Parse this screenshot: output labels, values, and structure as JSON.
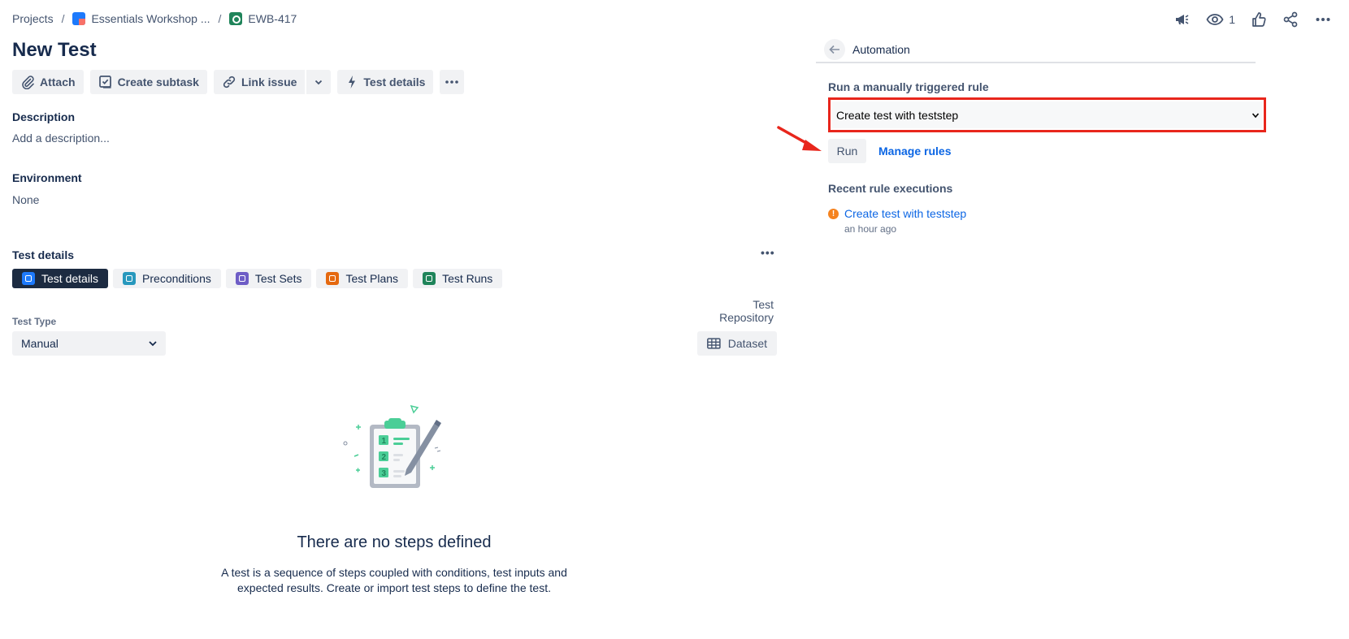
{
  "breadcrumb": {
    "projects": "Projects",
    "project": "Essentials Workshop ...",
    "issue_key": "EWB-417",
    "separator": "/"
  },
  "header_actions": {
    "watch_count": "1",
    "icons": [
      "megaphone-icon",
      "eye-icon",
      "thumbs-up-icon",
      "share-icon",
      "more-icon"
    ]
  },
  "issue": {
    "title": "New Test"
  },
  "toolbar": {
    "attach": "Attach",
    "create_subtask": "Create subtask",
    "link_issue": "Link issue",
    "test_details": "Test details"
  },
  "fields": {
    "description_label": "Description",
    "description_placeholder": "Add a description...",
    "environment_label": "Environment",
    "environment_value": "None"
  },
  "test_details": {
    "section_title": "Test details",
    "tabs": [
      {
        "label": "Test details",
        "color": "#1d7afc"
      },
      {
        "label": "Preconditions",
        "color": "#2898bd"
      },
      {
        "label": "Test Sets",
        "color": "#6e5dc6"
      },
      {
        "label": "Test Plans",
        "color": "#e56910"
      },
      {
        "label": "Test Runs",
        "color": "#1f845a"
      }
    ],
    "test_repository": "Test Repository",
    "test_type_label": "Test Type",
    "test_type_value": "Manual",
    "dataset": "Dataset",
    "empty_title": "There are no steps defined",
    "empty_description": "A test is a sequence of steps coupled with conditions, test inputs and expected results. Create or import test steps to define the test."
  },
  "automation": {
    "title": "Automation",
    "run_label": "Run a manually triggered rule",
    "selected_rule": "Create test with teststep",
    "run_button": "Run",
    "manage_rules": "Manage rules",
    "recent_label": "Recent rule executions",
    "recent": [
      {
        "name": "Create test with teststep",
        "time": "an hour ago",
        "status": "warning",
        "status_icon": "!"
      }
    ]
  },
  "colors": {
    "accent_blue": "#0c66e4",
    "highlight_red": "#e8261c",
    "active_tab": "#1c2b41",
    "warning_orange": "#f5831f"
  }
}
